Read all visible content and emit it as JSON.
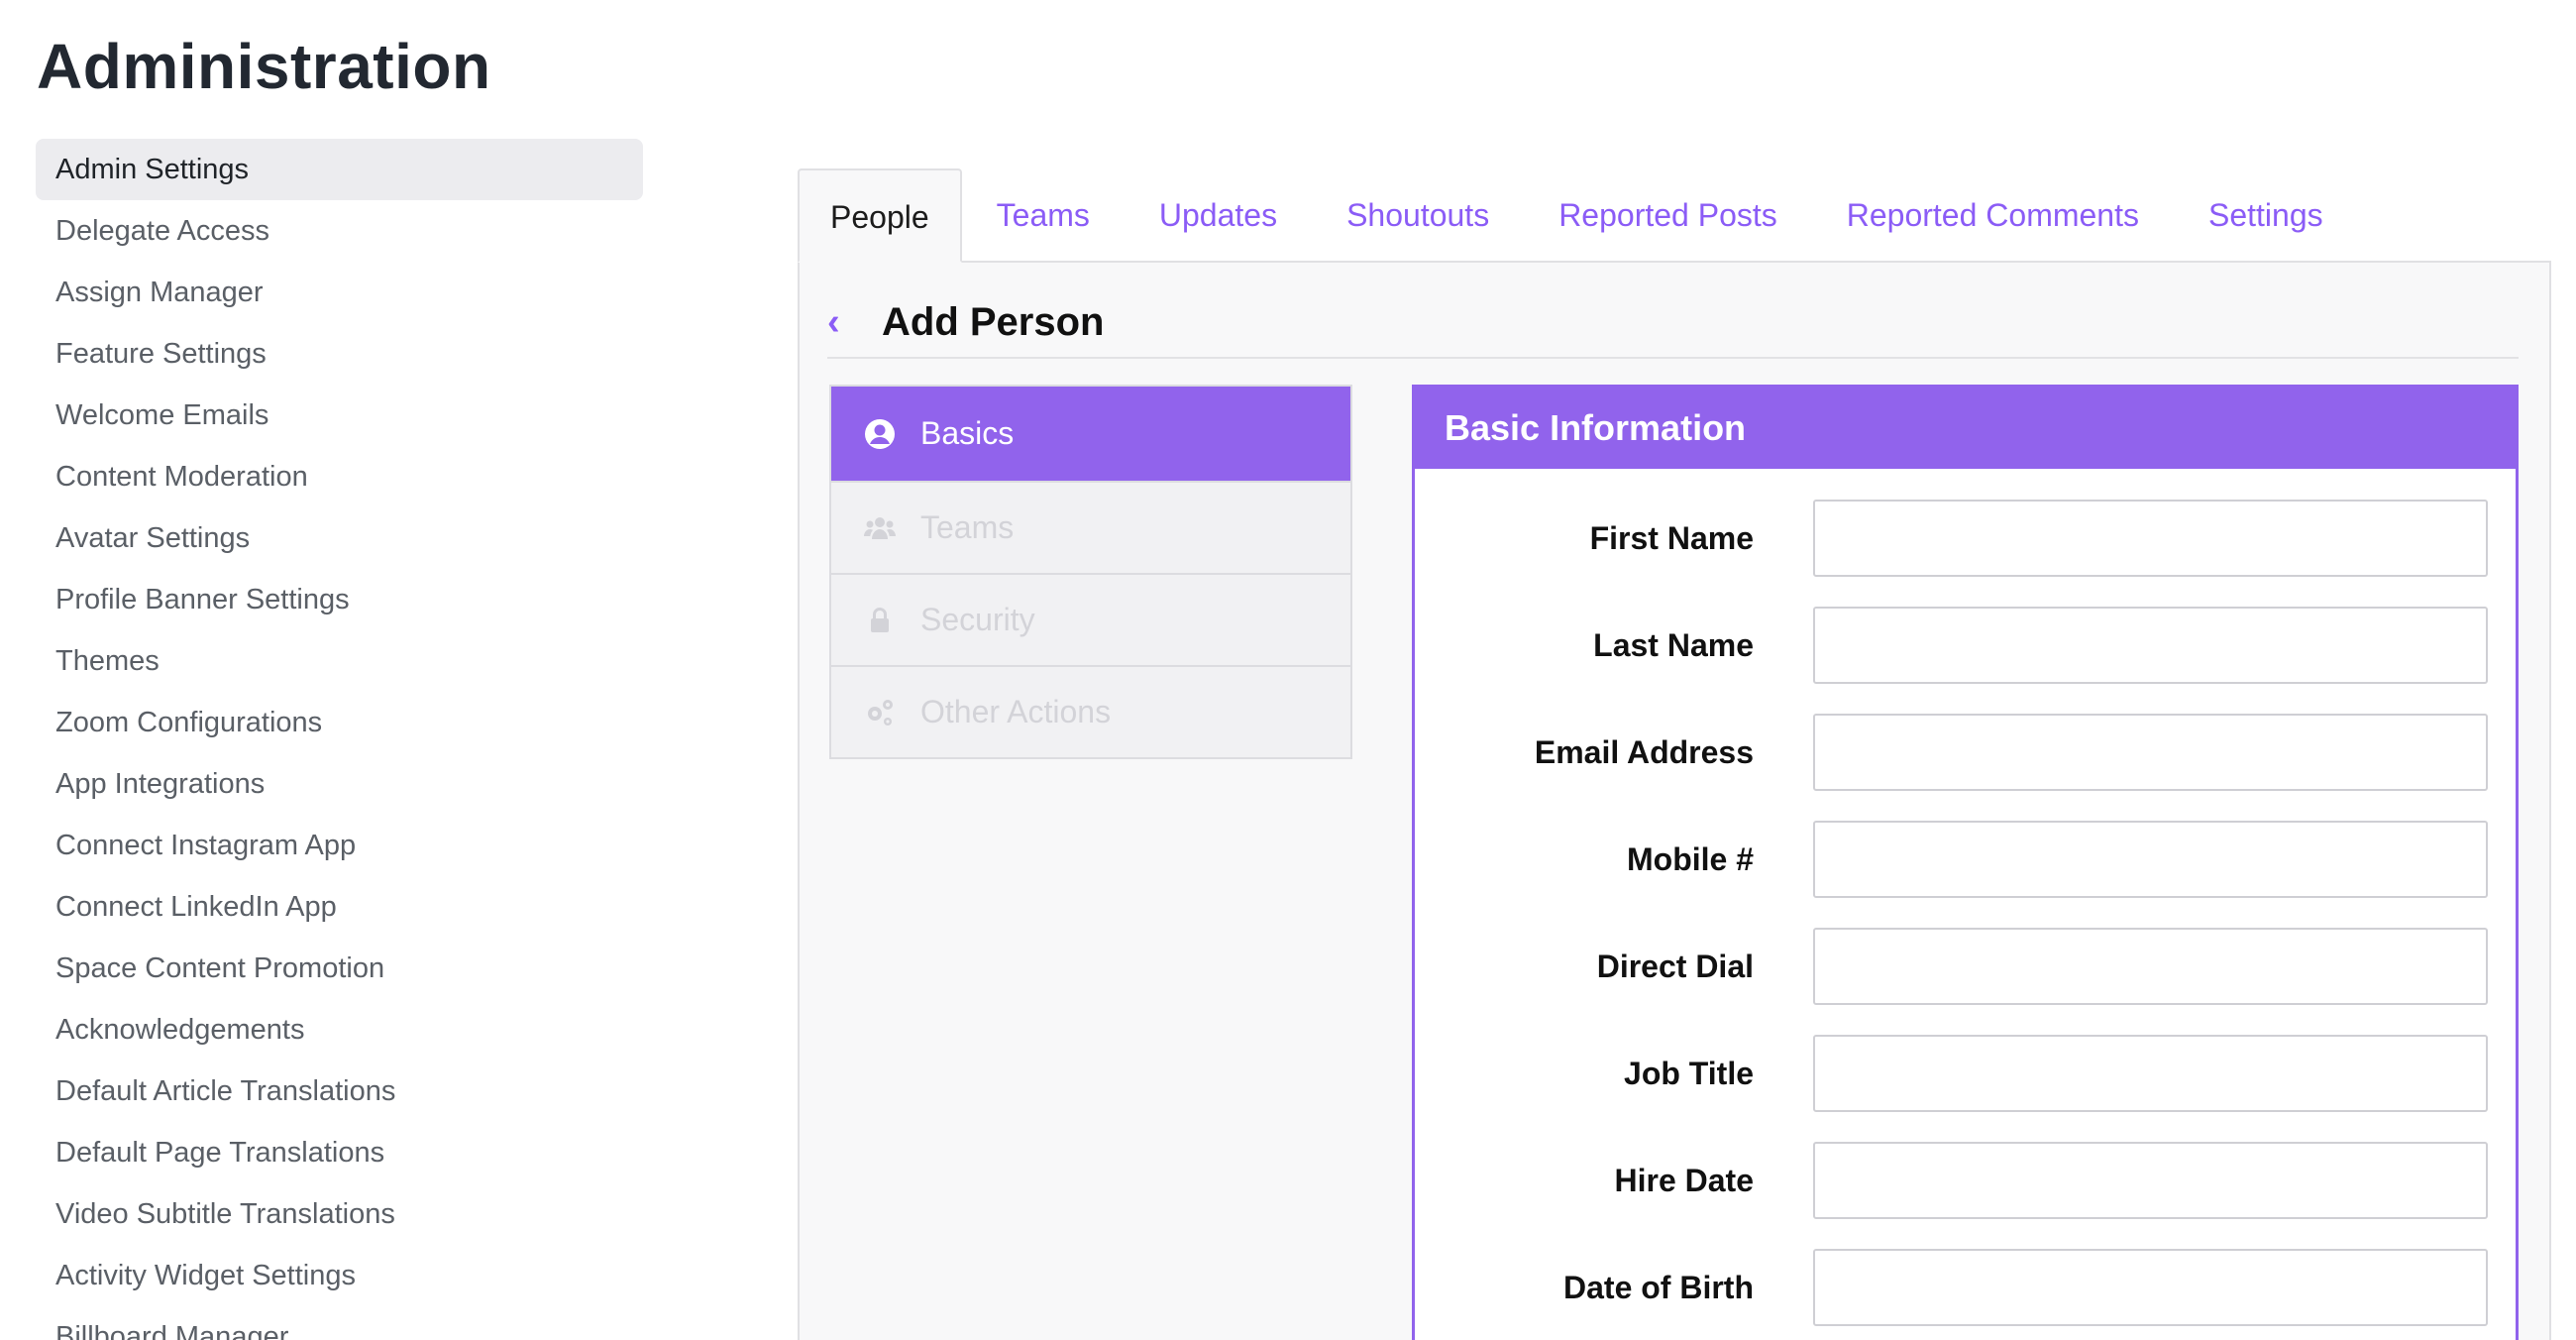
{
  "page": {
    "title": "Administration"
  },
  "sidebar": {
    "items": [
      {
        "label": "Admin Settings",
        "active": true
      },
      {
        "label": "Delegate Access"
      },
      {
        "label": "Assign Manager"
      },
      {
        "label": "Feature Settings"
      },
      {
        "label": "Welcome Emails"
      },
      {
        "label": "Content Moderation"
      },
      {
        "label": "Avatar Settings"
      },
      {
        "label": "Profile Banner Settings"
      },
      {
        "label": "Themes"
      },
      {
        "label": "Zoom Configurations"
      },
      {
        "label": "App Integrations"
      },
      {
        "label": "Connect Instagram App"
      },
      {
        "label": "Connect LinkedIn App"
      },
      {
        "label": "Space Content Promotion"
      },
      {
        "label": "Acknowledgements"
      },
      {
        "label": "Default Article Translations"
      },
      {
        "label": "Default Page Translations"
      },
      {
        "label": "Video Subtitle Translations"
      },
      {
        "label": "Activity Widget Settings"
      },
      {
        "label": "Billboard Manager"
      }
    ]
  },
  "tabs": [
    {
      "label": "People",
      "active": true
    },
    {
      "label": "Teams"
    },
    {
      "label": "Updates"
    },
    {
      "label": "Shoutouts"
    },
    {
      "label": "Reported Posts"
    },
    {
      "label": "Reported Comments"
    },
    {
      "label": "Settings"
    }
  ],
  "header": {
    "back_icon": "chevron-left-icon",
    "title": "Add Person"
  },
  "subnav": {
    "items": [
      {
        "label": "Basics",
        "icon": "user-circle-icon",
        "active": true
      },
      {
        "label": "Teams",
        "icon": "users-icon"
      },
      {
        "label": "Security",
        "icon": "lock-icon"
      },
      {
        "label": "Other Actions",
        "icon": "gears-icon"
      }
    ]
  },
  "card": {
    "title": "Basic Information",
    "fields": [
      {
        "label": "First Name",
        "value": ""
      },
      {
        "label": "Last Name",
        "value": ""
      },
      {
        "label": "Email Address",
        "value": ""
      },
      {
        "label": "Mobile #",
        "value": ""
      },
      {
        "label": "Direct Dial",
        "value": ""
      },
      {
        "label": "Job Title",
        "value": ""
      },
      {
        "label": "Hire Date",
        "value": ""
      },
      {
        "label": "Date of Birth",
        "value": ""
      }
    ]
  },
  "colors": {
    "accent": "#9163ec",
    "link": "#8b5cf6",
    "active_sidebar_bg": "#ececef"
  }
}
